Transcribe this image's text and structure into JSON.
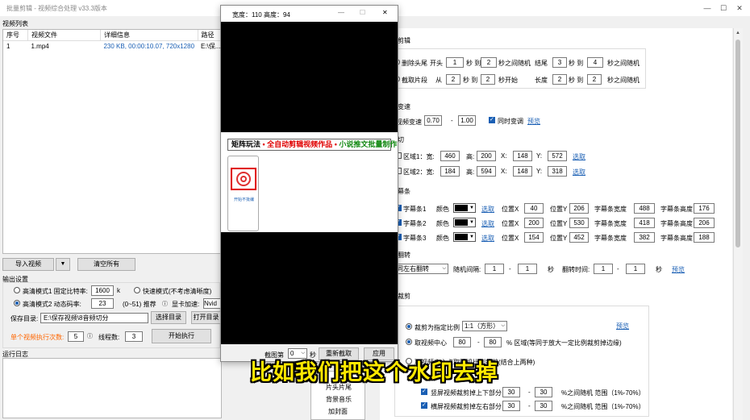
{
  "window": {
    "title": "批量剪辑 - 视频综合处理  v33.3版本"
  },
  "video_list": {
    "group_label": "视频列表",
    "columns": [
      "序号",
      "视频文件",
      "详细信息",
      "路径"
    ],
    "rows": [
      {
        "index": "1",
        "file": "1.mp4",
        "info": "230 KB, 00:00:10.07, 720x1280",
        "path": "E:\\保..."
      }
    ],
    "import_btn": "导入视频",
    "dropdown_arrow": "▼",
    "clear_btn": "清空所有"
  },
  "output": {
    "group_label": "输出设置",
    "mode1_label": "高清模式1 固定比特率:",
    "mode1_value": "1600",
    "mode1_unit": "k",
    "fast_label": "快速模式(不考虑清晰度)",
    "mode2_label": "高清模式2 动态码率:",
    "mode2_value": "23",
    "range_label": "(0~51) 推荐",
    "gpu_label": "显卡加速:",
    "gpu_value": "Nvid",
    "dir_label": "保存目录:",
    "dir_value": "E:\\保存视频\\8音频切分",
    "choose_dir_btn": "选择目录",
    "open_dir_btn": "打开目录",
    "times_label": "单个视频执行次数:",
    "times_value": "5",
    "threads_label": "线程数:",
    "threads_value": "3",
    "start_btn": "开始执行",
    "log_label": "运行日志"
  },
  "popup": {
    "title": "宽度：110 高度：94",
    "banner_black1": "矩阵玩法",
    "banner_red": "全自动剪辑视频作品",
    "banner_green": "小说推文批量制作",
    "thumb_caption": "开始不批编",
    "frame_label": "截图第",
    "frame_value": "0",
    "frame_unit": "秒",
    "recapture_btn": "重新截取",
    "apply_btn": "应用"
  },
  "cut": {
    "section": "剪辑",
    "trim_label": "删除头尾",
    "head_label": "开头",
    "head_from": "1",
    "to1": "秒 到",
    "head_to": "2",
    "head_rand": "秒之间随机",
    "tail_label": "结尾",
    "tail_from": "3",
    "tail_to": "4",
    "tail_rand": "秒之间随机",
    "clip_label": "截取片段",
    "from_label": "从",
    "clip_from": "2",
    "clip_to": "2",
    "clip_start": "秒开始",
    "length_label": "长度",
    "len_from": "2",
    "len_to": "2",
    "len_rand": "秒之间随机"
  },
  "speed": {
    "section": "变速",
    "label": "视频变速",
    "min": "0.70",
    "dash": "-",
    "max": "1.00",
    "sync_label": "同时变调",
    "preview": "预览"
  },
  "crop": {
    "section": "切",
    "r1_label": "区域1：宽:",
    "r1_w": "460",
    "r1_hl": "高:",
    "r1_h": "200",
    "r1_xl": "X:",
    "r1_x": "148",
    "r1_yl": "Y:",
    "r1_y": "572",
    "r1_pick": "选取",
    "r2_label": "区域2：宽:",
    "r2_w": "184",
    "r2_hl": "高:",
    "r2_h": "594",
    "r2_xl": "X:",
    "r2_x": "148",
    "r2_yl": "Y:",
    "r2_y": "318",
    "r2_pick": "选取"
  },
  "captions": {
    "section": "幕条",
    "color_label": "颜色",
    "pick": "选取",
    "x_label": "位置X",
    "y_label": "位置Y",
    "w_label": "字幕条宽度",
    "h_label": "字幕条高度",
    "rows": [
      {
        "name": "字幕条1",
        "x": "40",
        "y": "206",
        "w": "488",
        "h": "176"
      },
      {
        "name": "字幕条2",
        "x": "200",
        "y": "530",
        "w": "418",
        "h": "206"
      },
      {
        "name": "字幕条3",
        "x": "154",
        "y": "452",
        "w": "382",
        "h": "188"
      }
    ]
  },
  "flip": {
    "section": "翻转",
    "select_value": "同左右翻转",
    "interval_label": "随机间隔:",
    "int_from": "1",
    "int_dash": "-",
    "int_to": "1",
    "sec1": "秒",
    "time_label": "翻转时间:",
    "time_from": "1",
    "time_dash": "-",
    "time_to": "1",
    "sec2": "秒",
    "preview": "预览"
  },
  "resize": {
    "section": "裁剪",
    "ratio_label": "裁剪为指定比例",
    "ratio_value": "1:1（方形）",
    "preview": "预览",
    "center_label": "取视频中心",
    "center_from": "80",
    "center_dash": "-",
    "center_to": "80",
    "center_desc": "% 区域(等同于放大一定比例裁剪掉边缘)",
    "random_label": "取视频中心点取随机比例裁剪(结合上两种)",
    "vert_label": "竖屏视频裁剪掉上下部分",
    "vert_from": "30",
    "vert_dash": "-",
    "vert_to": "30",
    "vert_desc": "%之间随机  范围（1%-70%）",
    "horiz_label": "横屏视频裁剪掉左右部分",
    "horiz_from": "30",
    "horiz_dash": "-",
    "horiz_to": "30",
    "horiz_desc": "%之间随机  范围（1%-70%）"
  },
  "side_menu": [
    "片头片尾",
    "背景音乐",
    "加封面"
  ],
  "overlay_subtitle": "比如我们把这个水印去掉",
  "colors": {
    "accent": "#1a5fb4",
    "warning": "#ff6600",
    "subtitle": "#ffe800",
    "banner_red": "#e00000",
    "banner_green": "#118811"
  }
}
